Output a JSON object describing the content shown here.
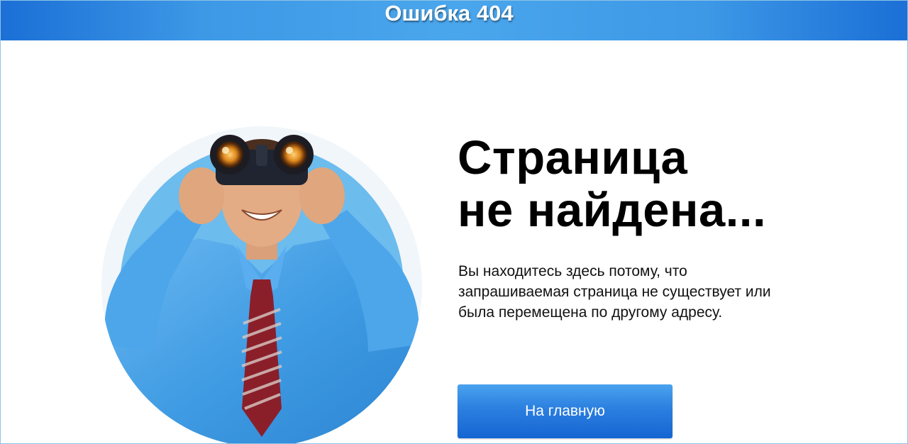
{
  "header": {
    "title": "Ошибка 404"
  },
  "illustration": {
    "icon": "man-with-binoculars-illustration"
  },
  "main": {
    "headline_line1": "Страница",
    "headline_line2": "не найдена...",
    "description": "Вы находитесь здесь потому, что запрашиваемая страница не существует или была перемещена по другому адресу.",
    "home_button_label": "На главную"
  },
  "colors": {
    "header_gradient_dark": "#1b6fd6",
    "header_gradient_light": "#4aa6ec",
    "button_blue": "#2b7fe0",
    "shirt_blue": "#3f9be3",
    "circle_bg": "#f1f6fa"
  }
}
